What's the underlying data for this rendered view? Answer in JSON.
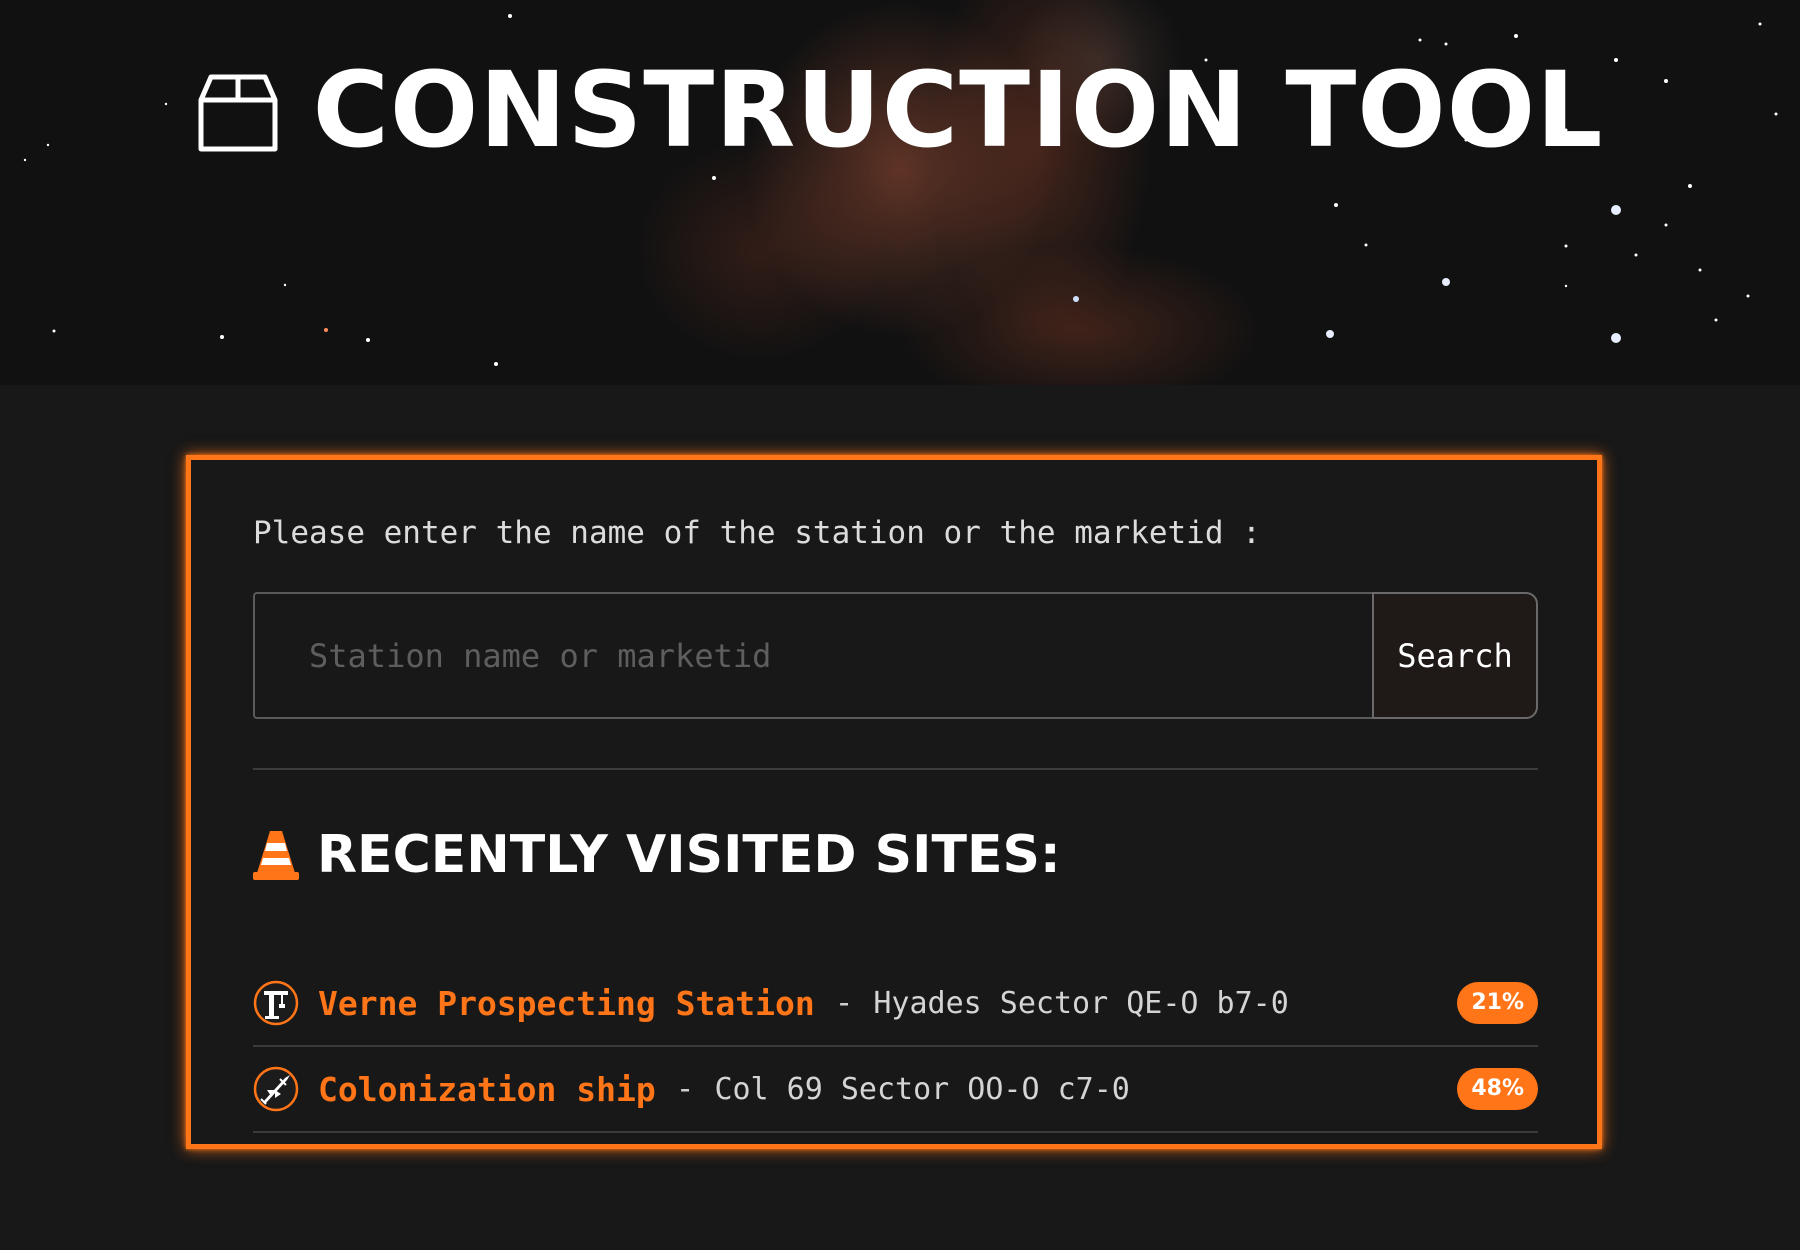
{
  "header": {
    "title": "CONSTRUCTION TOOL",
    "icon": "box-icon"
  },
  "search": {
    "prompt": "Please enter the name of the station or the marketid :",
    "placeholder": "Station name or marketid",
    "value": "",
    "button_label": "Search"
  },
  "recent": {
    "icon": "traffic-cone-icon",
    "title": "RECENTLY VISITED SITES:",
    "items": [
      {
        "name": "Verne Prospecting Station",
        "separator": "-",
        "system": "Hyades Sector QE-O b7-0",
        "progress": "21%",
        "icon": "crane-icon"
      },
      {
        "name": "Colonization ship",
        "separator": "-",
        "system": "Col 69 Sector OO-O c7-0",
        "progress": "48%",
        "icon": "ship-icon"
      }
    ]
  },
  "colors": {
    "accent": "#ff7518",
    "background": "#181818",
    "text": "#ffffff"
  }
}
